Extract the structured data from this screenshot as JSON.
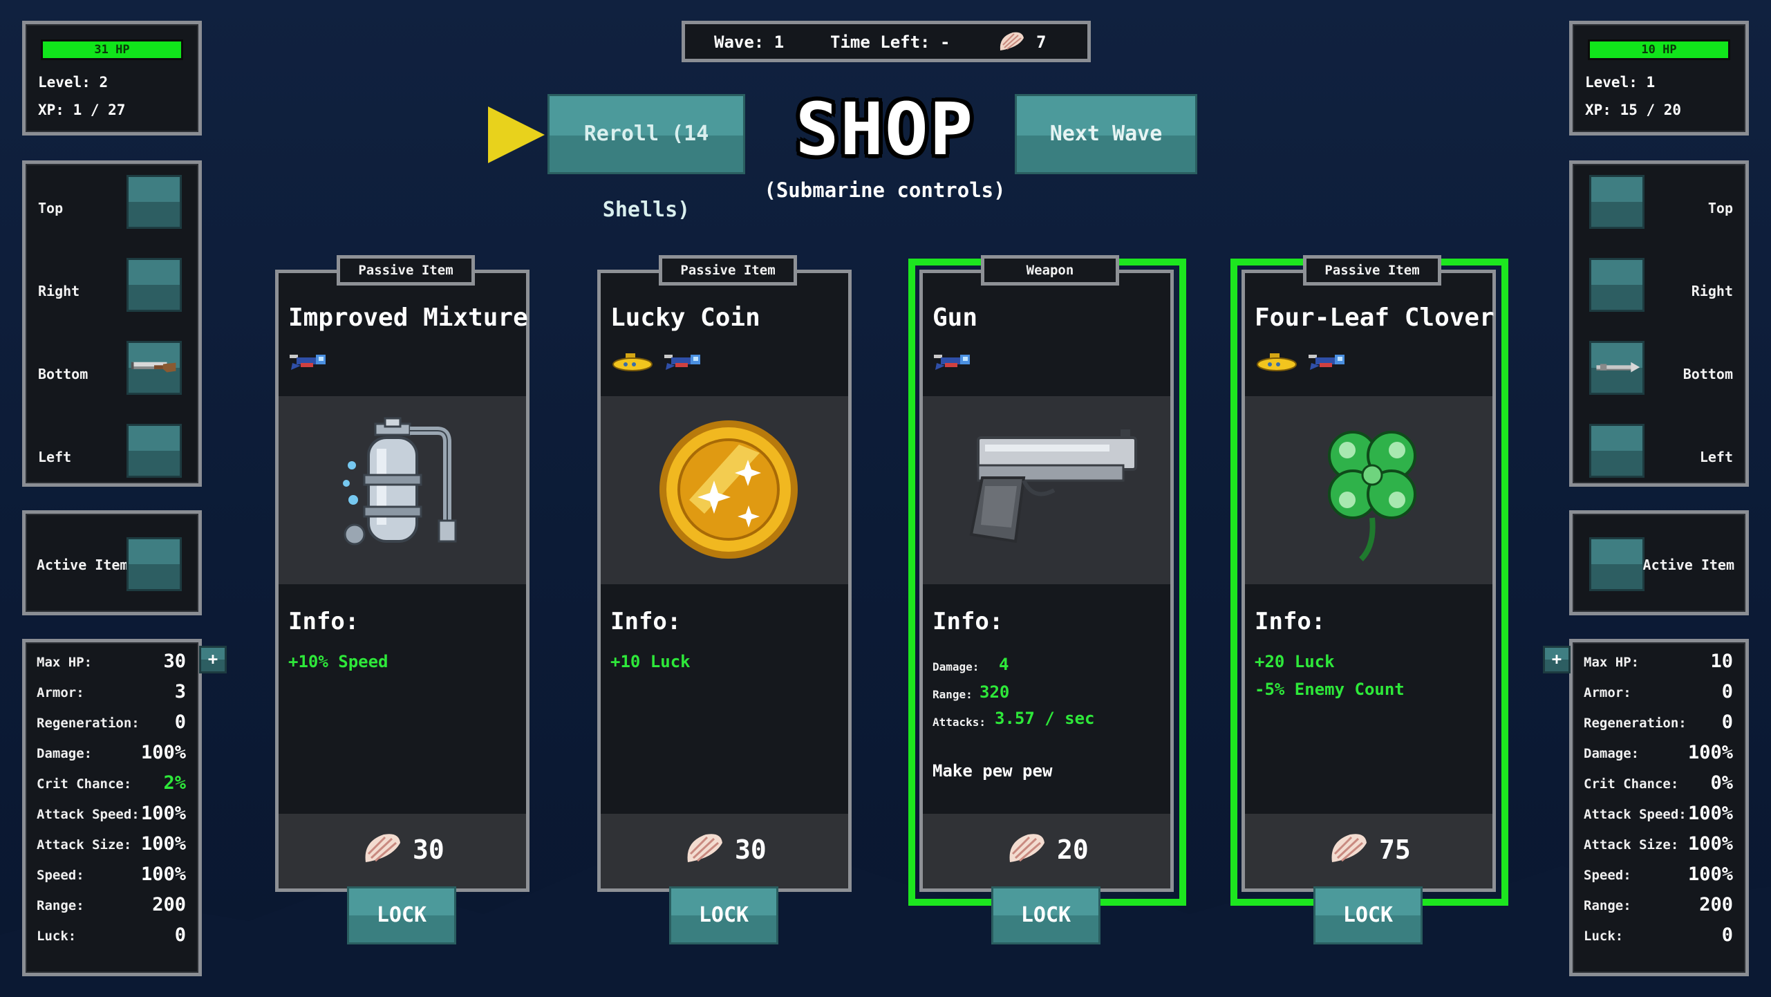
{
  "colors": {
    "background": "#0e1f3c",
    "panel": "#14171c",
    "panel_border": "#8b8e94",
    "teal_button": "#4c9a9b",
    "hp_green": "#11e51b",
    "stat_green": "#2ee83a",
    "highlight_green": "#1de61f",
    "arrow_yellow": "#e8d21c"
  },
  "top_bar": {
    "wave": "Wave: 1",
    "time_left": "Time Left: -",
    "shells": "7",
    "shell_icon": "seashell-icon"
  },
  "title": {
    "text": "SHOP",
    "subtitle": "(Submarine controls)"
  },
  "buttons": {
    "reroll": "Reroll (14 Shells)",
    "next_wave": "Next Wave"
  },
  "player_left": {
    "hp_text": "31 HP",
    "hp_fraction": 1.0,
    "level": "Level: 2",
    "xp": "XP: 1 / 27",
    "slots": [
      {
        "label": "Top",
        "icon": ""
      },
      {
        "label": "Right",
        "icon": ""
      },
      {
        "label": "Bottom",
        "icon": "shotgun-icon"
      },
      {
        "label": "Left",
        "icon": ""
      }
    ],
    "active_item": "Active Item",
    "stats": [
      {
        "name": "Max HP:",
        "value": "30"
      },
      {
        "name": "Armor:",
        "value": "3"
      },
      {
        "name": "Regeneration:",
        "value": "0"
      },
      {
        "name": "Damage:",
        "value": "100%"
      },
      {
        "name": "Crit Chance:",
        "value": "2%",
        "highlight": true
      },
      {
        "name": "Attack Speed:",
        "value": "100%"
      },
      {
        "name": "Attack Size:",
        "value": "100%"
      },
      {
        "name": "Speed:",
        "value": "100%"
      },
      {
        "name": "Range:",
        "value": "200"
      },
      {
        "name": "Luck:",
        "value": "0"
      }
    ],
    "plus": "+"
  },
  "player_right": {
    "hp_text": "10 HP",
    "hp_fraction": 1.0,
    "level": "Level: 1",
    "xp": "XP: 15 / 20",
    "slots": [
      {
        "label": "Top",
        "icon": ""
      },
      {
        "label": "Right",
        "icon": ""
      },
      {
        "label": "Bottom",
        "icon": "harpoon-icon"
      },
      {
        "label": "Left",
        "icon": ""
      }
    ],
    "active_item": "Active Item",
    "stats": [
      {
        "name": "Max HP:",
        "value": "10"
      },
      {
        "name": "Armor:",
        "value": "0"
      },
      {
        "name": "Regeneration:",
        "value": "0"
      },
      {
        "name": "Damage:",
        "value": "100%"
      },
      {
        "name": "Crit Chance:",
        "value": "0%"
      },
      {
        "name": "Attack Speed:",
        "value": "100%"
      },
      {
        "name": "Attack Size:",
        "value": "100%"
      },
      {
        "name": "Speed:",
        "value": "100%"
      },
      {
        "name": "Range:",
        "value": "200"
      },
      {
        "name": "Luck:",
        "value": "0"
      }
    ],
    "plus": "+"
  },
  "cards": [
    {
      "type": "Passive Item",
      "name": "Improved Mixture",
      "icons": [
        "diver-icon"
      ],
      "art": "oxygen-tank-icon",
      "info": "Info:",
      "effects": [
        "+10% Speed"
      ],
      "price": "30",
      "lock": "LOCK",
      "selected": false
    },
    {
      "type": "Passive Item",
      "name": "Lucky Coin",
      "icons": [
        "submarine-icon",
        "diver-icon"
      ],
      "art": "gold-coin-icon",
      "info": "Info:",
      "effects": [
        "+10 Luck"
      ],
      "price": "30",
      "lock": "LOCK",
      "selected": false
    },
    {
      "type": "Weapon",
      "name": "Gun",
      "icons": [
        "diver-icon"
      ],
      "art": "pistol-icon",
      "info": "Info:",
      "weapon_stats": [
        {
          "name": "Damage:",
          "value": "4"
        },
        {
          "name": "Range:",
          "value": "320"
        },
        {
          "name": "Attacks:",
          "value": "3.57 / sec"
        }
      ],
      "description": "Make pew pew",
      "price": "20",
      "lock": "LOCK",
      "selected": true
    },
    {
      "type": "Passive Item",
      "name": "Four-Leaf Clover",
      "icons": [
        "submarine-icon",
        "diver-icon"
      ],
      "art": "clover-icon",
      "info": "Info:",
      "effects": [
        "+20 Luck",
        "-5% Enemy Count"
      ],
      "price": "75",
      "lock": "LOCK",
      "selected": true
    }
  ]
}
